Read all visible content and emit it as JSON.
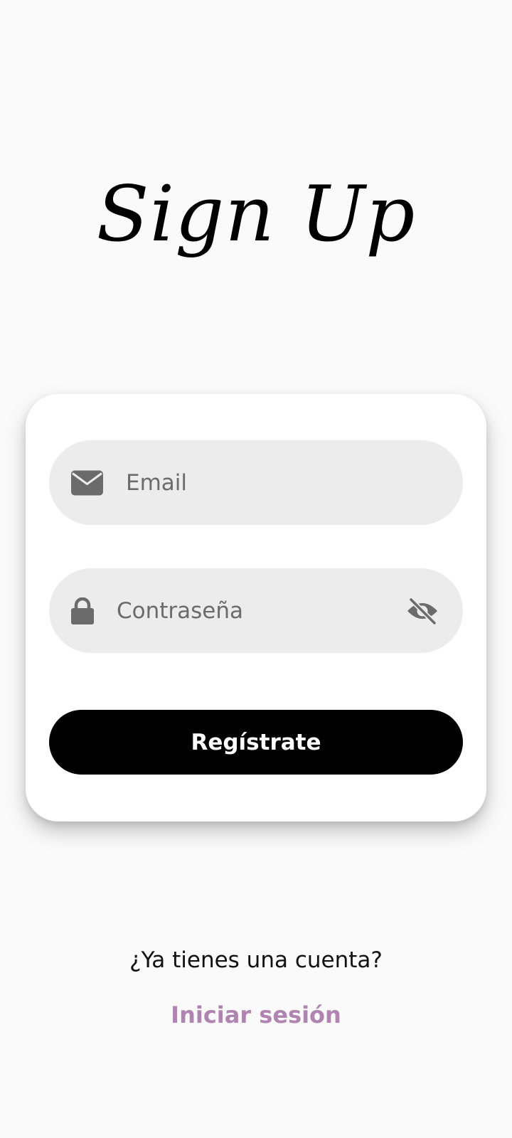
{
  "header": {
    "title": "Sign Up"
  },
  "form": {
    "email": {
      "placeholder": "Email",
      "value": "",
      "icon": "mail-icon"
    },
    "password": {
      "placeholder": "Contraseña",
      "value": "",
      "icon": "lock-icon",
      "toggle_icon": "eye-off-icon"
    },
    "submit_label": "Regístrate"
  },
  "footer": {
    "question": "¿Ya tienes una cuenta?",
    "login_label": "Iniciar sesión"
  },
  "colors": {
    "background": "#fafafa",
    "card": "#ffffff",
    "field": "#ececec",
    "button": "#000000",
    "link": "#b084b0",
    "icon": "#6b6b6b"
  }
}
